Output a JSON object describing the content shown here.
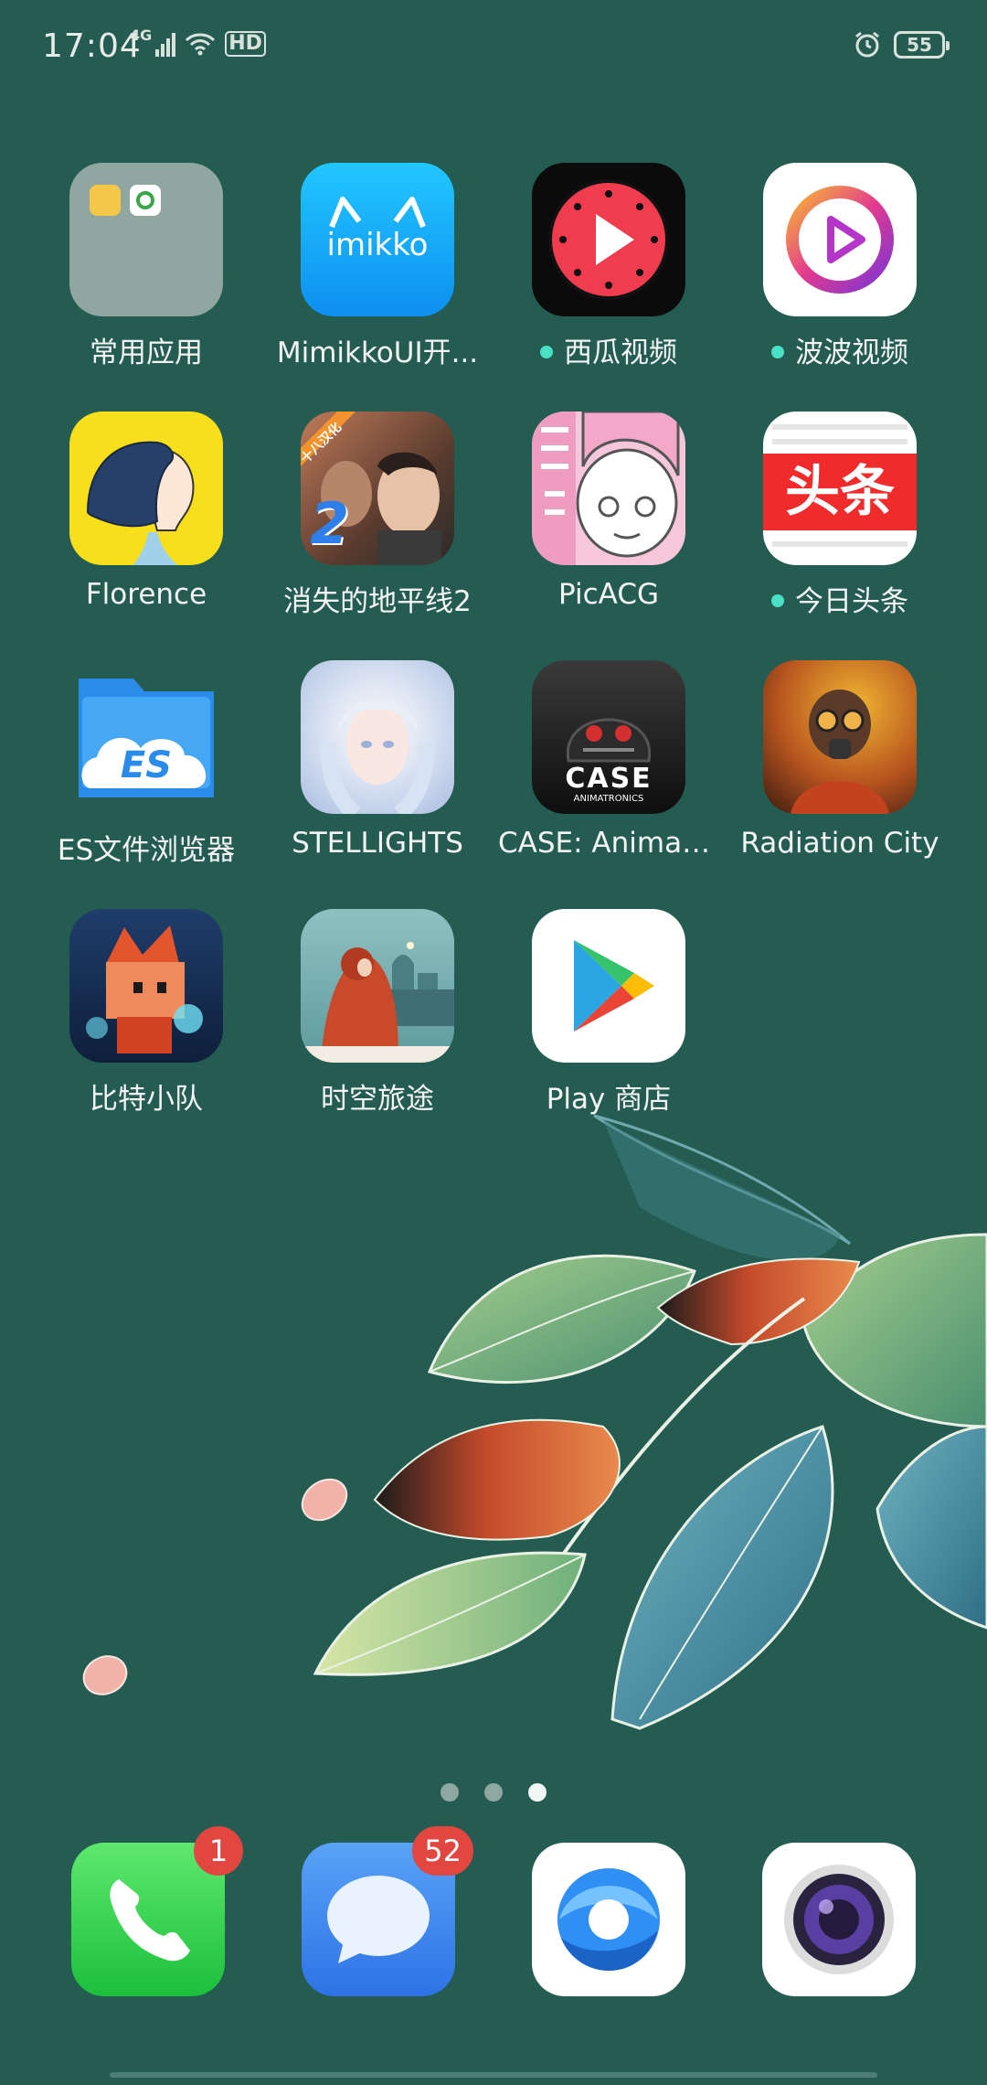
{
  "status_bar": {
    "time": "17:04",
    "network": "4G",
    "hd": "HD",
    "battery": "55"
  },
  "apps": [
    {
      "label": "常用应用",
      "icon": "folder-icon",
      "dot": false
    },
    {
      "label": "MimikkoUI开...",
      "icon": "mimikko-icon",
      "icon_text": "imikko",
      "dot": false
    },
    {
      "label": "西瓜视频",
      "icon": "xigua-video-icon",
      "dot": true
    },
    {
      "label": "波波视频",
      "icon": "bobo-video-icon",
      "dot": true
    },
    {
      "label": "Florence",
      "icon": "florence-icon",
      "dot": false
    },
    {
      "label": "消失的地平线2",
      "icon": "lost-horizon-2-icon",
      "icon_text": "十八汉化",
      "icon_number": "2",
      "dot": false
    },
    {
      "label": "PicACG",
      "icon": "picacg-icon",
      "dot": false
    },
    {
      "label": "今日头条",
      "icon": "toutiao-icon",
      "icon_text": "头条",
      "dot": true
    },
    {
      "label": "ES文件浏览器",
      "icon": "es-file-explorer-icon",
      "icon_text": "ES",
      "dot": false
    },
    {
      "label": "STELLIGHTS",
      "icon": "stellights-icon",
      "dot": false
    },
    {
      "label": "CASE: Animatr...",
      "icon": "case-animatronics-icon",
      "icon_text": "CASE",
      "icon_subtext": "ANIMATRONICS",
      "dot": false
    },
    {
      "label": "Radiation City",
      "icon": "radiation-city-icon",
      "dot": false
    },
    {
      "label": "比特小队",
      "icon": "bit-squad-icon",
      "dot": false
    },
    {
      "label": "时空旅途",
      "icon": "time-journey-icon",
      "dot": false
    },
    {
      "label": "Play 商店",
      "icon": "play-store-icon",
      "dot": false
    }
  ],
  "dock": [
    {
      "name": "phone",
      "icon": "phone-icon",
      "badge": "1"
    },
    {
      "name": "messages",
      "icon": "messages-icon",
      "badge": "52"
    },
    {
      "name": "browser",
      "icon": "browser-icon",
      "badge": ""
    },
    {
      "name": "camera",
      "icon": "camera-icon",
      "badge": ""
    }
  ],
  "pages": {
    "count": 3,
    "active": 3
  },
  "colors": {
    "background": "#255c52",
    "notification_dot": "#49e0c6",
    "badge": "#e24640"
  }
}
